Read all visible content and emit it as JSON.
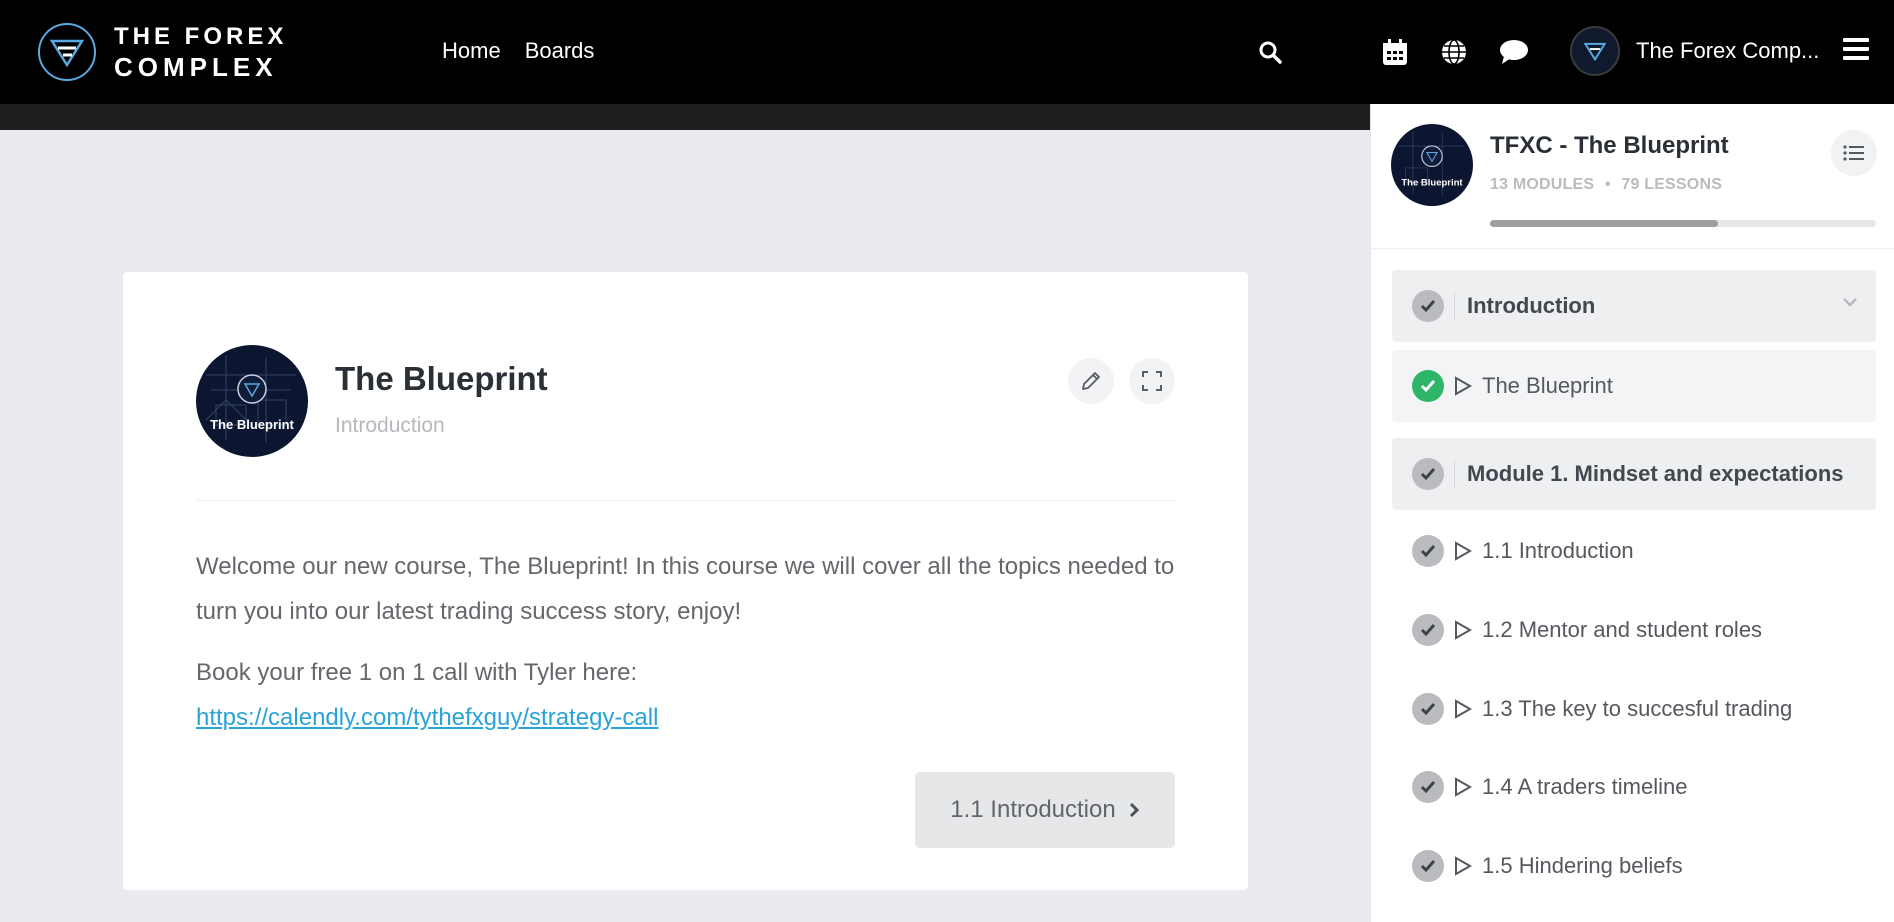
{
  "header": {
    "logo_line1": "THE FOREX",
    "logo_line2": "COMPLEX",
    "nav": [
      "Home",
      "Boards"
    ],
    "user_name": "The Forex Comp..."
  },
  "lesson": {
    "avatar_text": "The Blueprint",
    "title": "The Blueprint",
    "subtitle": "Introduction",
    "paragraph1": "Welcome our new course, The Blueprint! In this course we will cover all the topics needed to turn you into our latest trading success story, enjoy!",
    "paragraph2": "Book your free 1 on 1 call with Tyler here:",
    "link": "https://calendly.com/tythefxguy/strategy-call",
    "next_button": "1.1 Introduction"
  },
  "sidebar": {
    "avatar_text": "The Blueprint",
    "course_title": "TFXC - The Blueprint",
    "modules": "13 MODULES",
    "bullet": "•",
    "lessons_count": "79 LESSONS",
    "progress": 0.59,
    "sections": [
      {
        "label": "Introduction"
      },
      {
        "label": "Module 1. Mindset and expectations"
      }
    ],
    "lessons": [
      {
        "label": "The Blueprint",
        "status": "complete",
        "active": true
      },
      {
        "label": "1.1 Introduction",
        "status": "incomplete"
      },
      {
        "label": "1.2 Mentor and student roles",
        "status": "incomplete"
      },
      {
        "label": "1.3 The key to succesful trading",
        "status": "incomplete"
      },
      {
        "label": "1.4 A traders timeline",
        "status": "incomplete"
      },
      {
        "label": "1.5 Hindering beliefs",
        "status": "incomplete"
      }
    ]
  },
  "colors": {
    "accent_link": "#2aa3d8",
    "complete_green": "#2fb567",
    "logo_blue": "#5aa8e0"
  }
}
